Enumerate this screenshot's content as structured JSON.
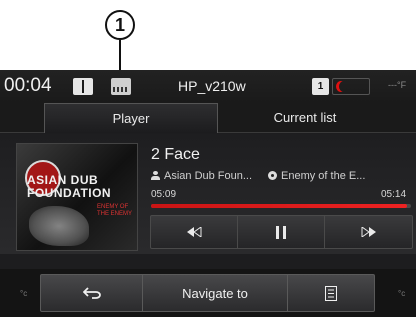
{
  "callout": {
    "number": "1"
  },
  "status": {
    "time": "00:04",
    "device_name": "HP_v210w",
    "badge": "1",
    "temp_unit": "---°F"
  },
  "tabs": [
    {
      "label": "Player",
      "active": true
    },
    {
      "label": "Current list",
      "active": false
    }
  ],
  "album_art": {
    "text": "ASIAN DUB FOUNDATION",
    "subtext": "ENEMY OF THE ENEMY"
  },
  "track": {
    "title": "2 Face",
    "artist": "Asian Dub Foun...",
    "album": "Enemy of the E...",
    "elapsed": "05:09",
    "total": "05:14",
    "progress": 0.984
  },
  "controls": {
    "prev": "previous-icon",
    "pause": "pause-icon",
    "next": "next-icon"
  },
  "bottom": {
    "back_icon": "back-arrow-icon",
    "navigate_label": "Navigate to",
    "menu_icon": "list-menu-icon",
    "temp_left": "°c",
    "temp_right": "°c"
  },
  "colors": {
    "accent": "#e01010",
    "background": "#1d1d1f",
    "text": "#f0f0f0"
  }
}
